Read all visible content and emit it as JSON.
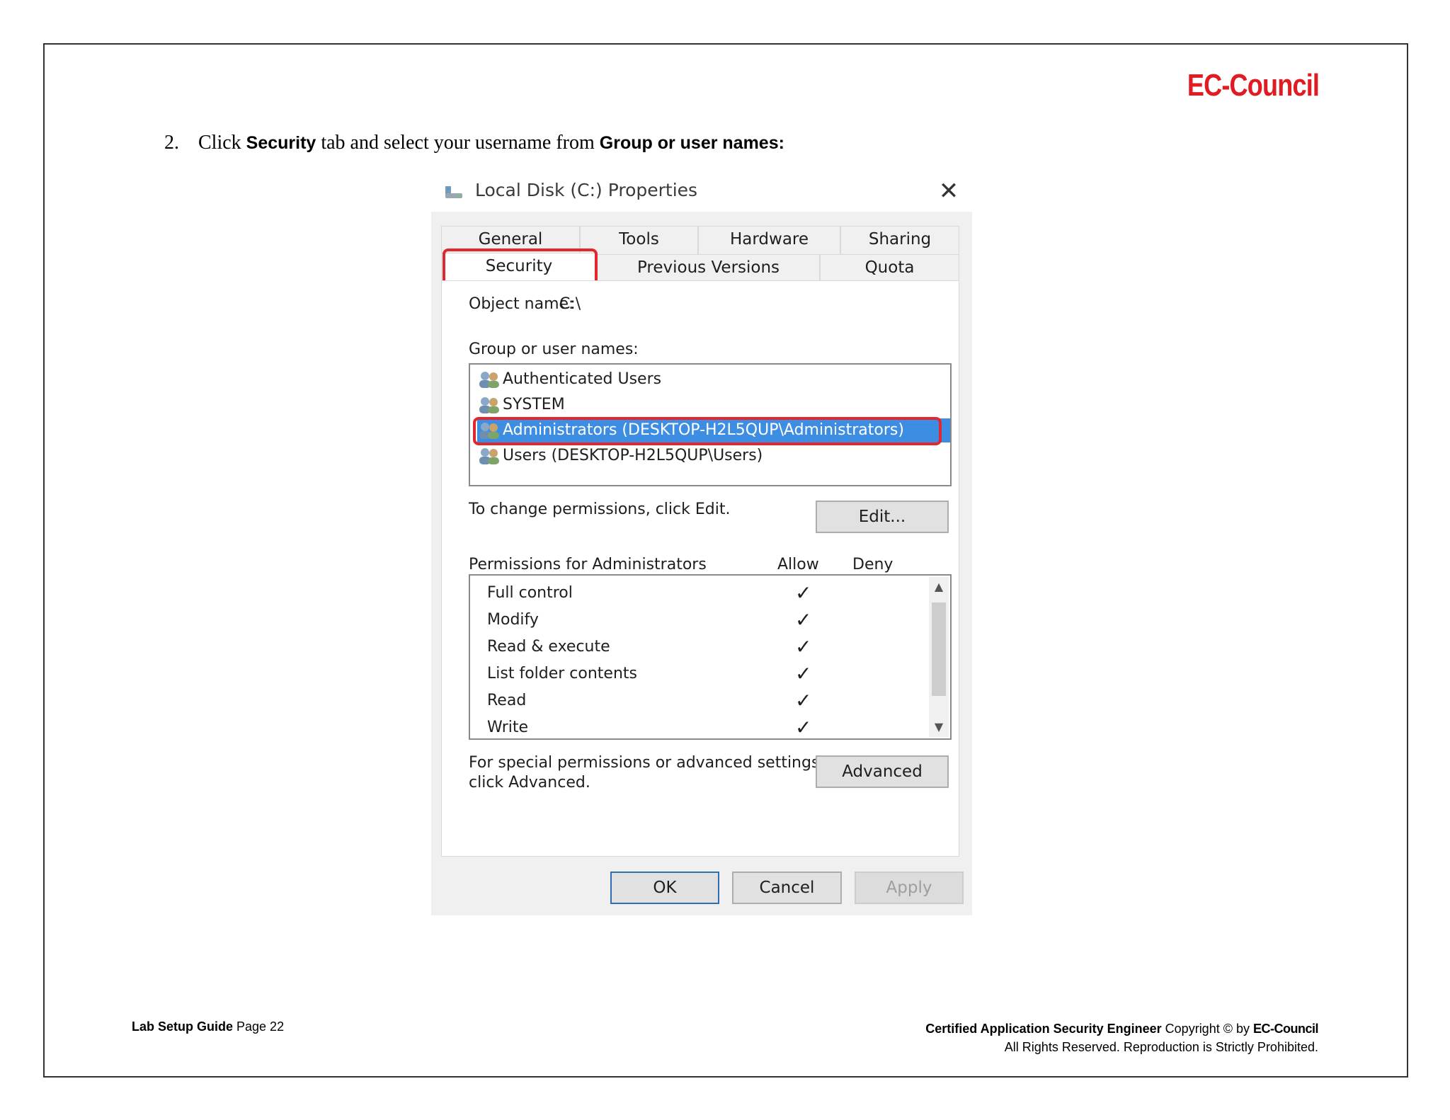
{
  "header": {
    "logo": "EC-Council"
  },
  "instruction": {
    "number": "2.",
    "part1": "Click ",
    "security": "Security",
    "part2": " tab and select your username from ",
    "group": "Group or user names:"
  },
  "dialog": {
    "title": "Local Disk (C:) Properties",
    "close": "✕",
    "tabs_row1": [
      "General",
      "Tools",
      "Hardware",
      "Sharing"
    ],
    "tabs_row2": [
      "Security",
      "Previous Versions",
      "Quota"
    ],
    "object_name_label": "Object name:",
    "object_name_value": "C:\\",
    "group_label": "Group or user names:",
    "users": [
      "Authenticated Users",
      "SYSTEM",
      "Administrators (DESKTOP-H2L5QUP\\Administrators)",
      "Users (DESKTOP-H2L5QUP\\Users)"
    ],
    "change_text": "To change permissions, click Edit.",
    "edit_button": "Edit...",
    "permissions_label": "Permissions for Administrators",
    "allow_label": "Allow",
    "deny_label": "Deny",
    "permissions": [
      {
        "name": "Full control",
        "allow": "✓"
      },
      {
        "name": "Modify",
        "allow": "✓"
      },
      {
        "name": "Read & execute",
        "allow": "✓"
      },
      {
        "name": "List folder contents",
        "allow": "✓"
      },
      {
        "name": "Read",
        "allow": "✓"
      },
      {
        "name": "Write",
        "allow": "✓"
      }
    ],
    "special_text_1": "For special permissions or advanced settings,",
    "special_text_2": "click Advanced.",
    "advanced_button": "Advanced",
    "ok_button": "OK",
    "cancel_button": "Cancel",
    "apply_button": "Apply",
    "selected_color": "#3d8ee3",
    "highlight_color": "#e0282e"
  },
  "footer": {
    "guide": "Lab Setup Guide",
    "page": " Page 22",
    "course": "Certified Application Security Engineer",
    "copyright": " Copyright © by ",
    "logo": "EC-Council",
    "rights": "All Rights Reserved. Reproduction is Strictly Prohibited."
  }
}
